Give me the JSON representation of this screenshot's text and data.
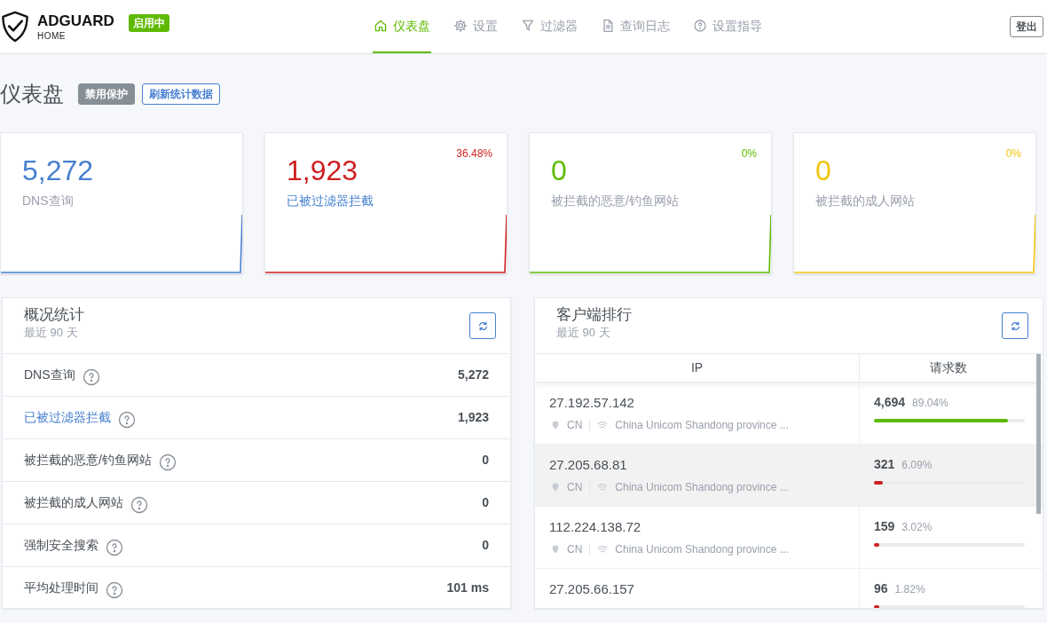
{
  "header": {
    "logo": {
      "name": "ADGUARD",
      "sub": "HOME"
    },
    "status_badge": "启用中",
    "nav": [
      {
        "label": "仪表盘",
        "selected": true
      },
      {
        "label": "设置",
        "selected": false
      },
      {
        "label": "过滤器",
        "selected": false
      },
      {
        "label": "查询日志",
        "selected": false
      },
      {
        "label": "设置指导",
        "selected": false
      }
    ],
    "logout": "登出"
  },
  "page": {
    "title": "仪表盘",
    "buttons": [
      {
        "label": "禁用保护",
        "kind": "secondary"
      },
      {
        "label": "刷新统计数据",
        "kind": "outline"
      }
    ]
  },
  "stat_cards": [
    {
      "value": "5,272",
      "label": "DNS查询",
      "color": "#467fcf",
      "link": false
    },
    {
      "value": "1,923",
      "label": "已被过滤器拦截",
      "percent": "36.48%",
      "color": "#cd201f",
      "link": true
    },
    {
      "value": "0",
      "label": "被拦截的恶意/钓鱼网站",
      "percent": "0%",
      "color": "#5eba00",
      "link": false
    },
    {
      "value": "0",
      "label": "被拦截的成人网站",
      "percent": "0%",
      "color": "#f1c40f",
      "link": false
    }
  ],
  "summary": {
    "title": "概况统计",
    "subtitle": "最近 90 天",
    "rows": [
      {
        "label": "DNS查询",
        "value": "5,272",
        "link": false
      },
      {
        "label": "已被过滤器拦截",
        "value": "1,923",
        "link": true
      },
      {
        "label": "被拦截的恶意/钓鱼网站",
        "value": "0",
        "link": false
      },
      {
        "label": "被拦截的成人网站",
        "value": "0",
        "link": false
      },
      {
        "label": "强制安全搜索",
        "value": "0",
        "link": false
      },
      {
        "label": "平均处理时间",
        "value": "101 ms",
        "link": false
      }
    ]
  },
  "clients": {
    "title": "客户端排行",
    "subtitle": "最近 90 天",
    "columns": [
      "IP",
      "请求数"
    ],
    "rows": [
      {
        "ip": "27.192.57.142",
        "country": "CN",
        "network": "China Unicom Shandong province ...",
        "count": "4,694",
        "percent": "89.04%",
        "level": 0.8904,
        "color": "#5eba00",
        "highlighted": false
      },
      {
        "ip": "27.205.68.81",
        "country": "CN",
        "network": "China Unicom Shandong province ...",
        "count": "321",
        "percent": "6.09%",
        "level": 0.0609,
        "color": "#cd201f",
        "highlighted": true
      },
      {
        "ip": "112.224.138.72",
        "country": "CN",
        "network": "China Unicom Shandong province ...",
        "count": "159",
        "percent": "3.02%",
        "level": 0.0302,
        "color": "#cd201f",
        "highlighted": false
      },
      {
        "ip": "27.205.66.157",
        "count": "96",
        "percent": "1.82%",
        "level": 0.0182,
        "color": "#cd201f",
        "highlighted": false
      }
    ]
  }
}
